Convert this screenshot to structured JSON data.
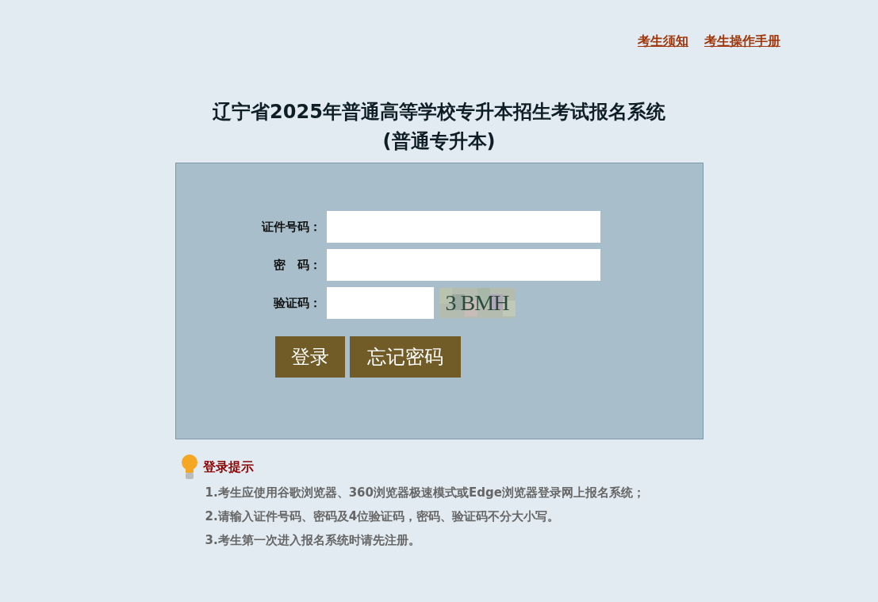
{
  "top_links": [
    "考生须知",
    "考生操作手册"
  ],
  "title": {
    "line1": "辽宁省2025年普通高等学校专升本招生考试报名系统",
    "line2": "(普通专升本)"
  },
  "form": {
    "fields": [
      {
        "label": "证件号码：",
        "kind": "text"
      },
      {
        "label": "密　码：",
        "kind": "password"
      },
      {
        "label": "验证码：",
        "kind": "captcha",
        "captcha": "3 BMH"
      }
    ],
    "buttons": [
      "登录",
      "忘记密码"
    ]
  },
  "tips": {
    "heading": "登录提示",
    "items": [
      "1.考生应使用谷歌浏览器、360浏览器极速模式或Edge浏览器登录网上报名系统；",
      "2.请输入证件号码、密码及4位验证码，密码、验证码不分大小写。",
      "3.考生第一次进入报名系统时请先注册。"
    ]
  }
}
